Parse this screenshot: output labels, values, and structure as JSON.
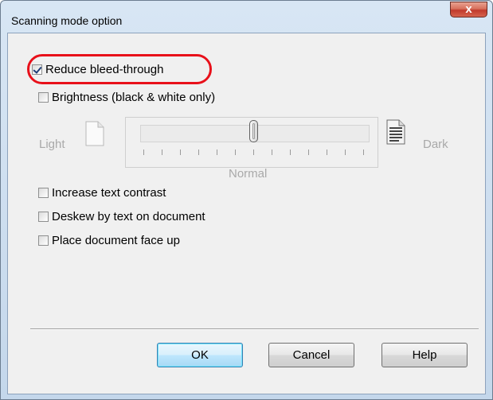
{
  "window": {
    "title": "Scanning mode option",
    "close_glyph": "x"
  },
  "options": {
    "reduce_bleed": {
      "label": "Reduce bleed-through",
      "checked": true
    },
    "brightness": {
      "label": "Brightness (black & white only)",
      "checked": false
    },
    "increase_contrast": {
      "label": "Increase text contrast",
      "checked": false
    },
    "deskew": {
      "label": "Deskew by text on document",
      "checked": false
    },
    "face_up": {
      "label": "Place document face up",
      "checked": false
    }
  },
  "brightness_slider": {
    "min_label": "Light",
    "max_label": "Dark",
    "center_label": "Normal",
    "value": 0.5,
    "tick_count": 13,
    "enabled": false
  },
  "buttons": {
    "ok": "OK",
    "cancel": "Cancel",
    "help": "Help"
  },
  "colors": {
    "highlight": "#e8101a",
    "close_button": "#c0392b",
    "default_button_border": "#3c7fb1"
  },
  "icons": {
    "light_doc": "blank-document-icon",
    "dark_doc": "text-document-icon",
    "close": "close-icon"
  }
}
